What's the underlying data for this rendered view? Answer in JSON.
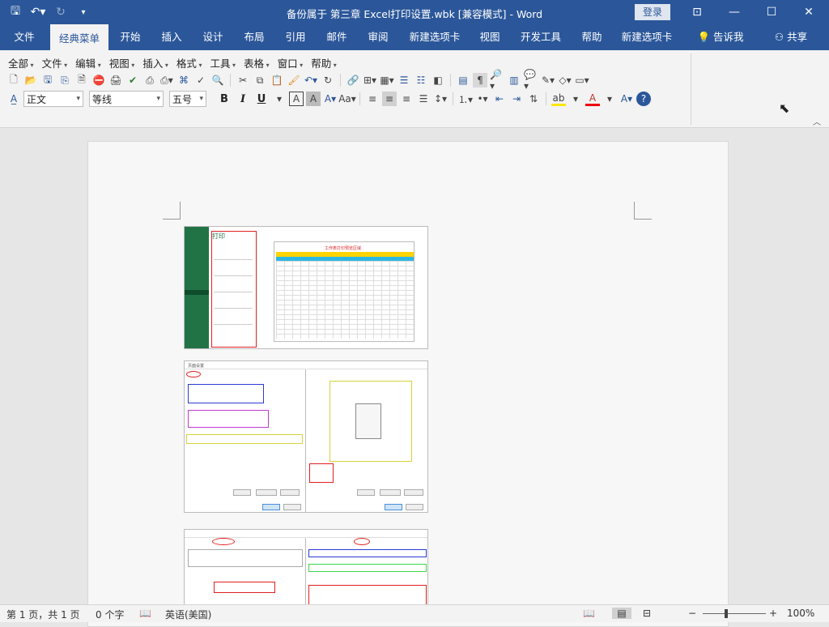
{
  "titlebar": {
    "title": "备份属于 第三章 Excel打印设置.wbk [兼容模式]  -  Word",
    "login": "登录",
    "icons": [
      "save-icon",
      "undo-icon",
      "redo-icon",
      "customize-icon"
    ],
    "window_icons": [
      "ribbon-display-icon",
      "minimize-icon",
      "restore-icon",
      "close-icon"
    ]
  },
  "tabs": [
    {
      "label": "文件"
    },
    {
      "label": "经典菜单"
    },
    {
      "label": "开始"
    },
    {
      "label": "插入"
    },
    {
      "label": "设计"
    },
    {
      "label": "布局"
    },
    {
      "label": "引用"
    },
    {
      "label": "邮件"
    },
    {
      "label": "审阅"
    },
    {
      "label": "新建选项卡"
    },
    {
      "label": "视图"
    },
    {
      "label": "开发工具"
    },
    {
      "label": "帮助"
    },
    {
      "label": "新建选项卡"
    }
  ],
  "tell_me": "告诉我",
  "share": "共享",
  "menus": [
    "全部",
    "文件",
    "编辑",
    "视图",
    "插入",
    "格式",
    "工具",
    "表格",
    "窗口",
    "帮助"
  ],
  "font": {
    "style": "正文",
    "name": "等线",
    "size": "五号",
    "bold": "B",
    "italic": "I",
    "underline": "U"
  },
  "colors": {
    "titlebar": "#2b579a",
    "excel_green": "#217346",
    "highlight_red": "#e02020",
    "highlight_blue": "#2a3bd6",
    "highlight_purple": "#c23ad6",
    "highlight_yellow": "#d6d23a",
    "highlight_green": "#3ad64a"
  },
  "embedded": {
    "excel_print_title": "打印",
    "excel_sheet_title": "工作表打印预览区域",
    "page_setup_title": "页面设置"
  },
  "status": {
    "page": "第 1 页，共 1 页",
    "words": "0 个字",
    "language": "英语(美国)",
    "zoom": "100%",
    "zoom_minus": "−",
    "zoom_plus": "+"
  }
}
